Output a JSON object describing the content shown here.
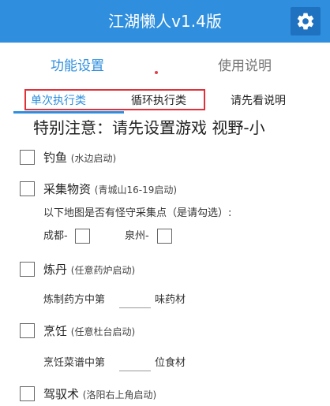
{
  "app": {
    "title": "江湖懒人v1.4版",
    "settings_icon": "gear-icon"
  },
  "tabs": {
    "function_settings": "功能设置",
    "usage_instructions": "使用说明"
  },
  "subtabs": {
    "single_exec": "单次执行类",
    "loop_exec": "循环执行类",
    "read_first": "请先看说明"
  },
  "notice": "特别注意：请先设置游戏   视野-小",
  "items": {
    "fishing": {
      "label": "钓鱼",
      "hint": "(水边启动)",
      "checked": false
    },
    "gather": {
      "label": "采集物资",
      "hint": "(青城山16-19启动)",
      "checked": false
    },
    "gather_question": "以下地图是否有怪守采集点（是请勾选）:",
    "chengdu": {
      "label": "成都-",
      "checked": false
    },
    "quanzhou": {
      "label": "泉州-",
      "checked": false
    },
    "alchemy": {
      "label": "炼丹",
      "hint": "(任意药炉启动)",
      "checked": false
    },
    "alchemy_line": {
      "prefix": "炼制药方中第",
      "value": "",
      "suffix": "味药材"
    },
    "cooking": {
      "label": "烹饪",
      "hint": "(任意杜台启动)",
      "checked": false
    },
    "cooking_line": {
      "prefix": "烹饪菜谱中第",
      "value": "",
      "suffix": "位食材"
    },
    "driving": {
      "label": "驾驭术",
      "hint": "(洛阳右上角启动)",
      "checked": false
    }
  },
  "colors": {
    "primary": "#2f8fde",
    "primary_dark": "#1f72c0",
    "highlight_box": "#e2303a"
  }
}
